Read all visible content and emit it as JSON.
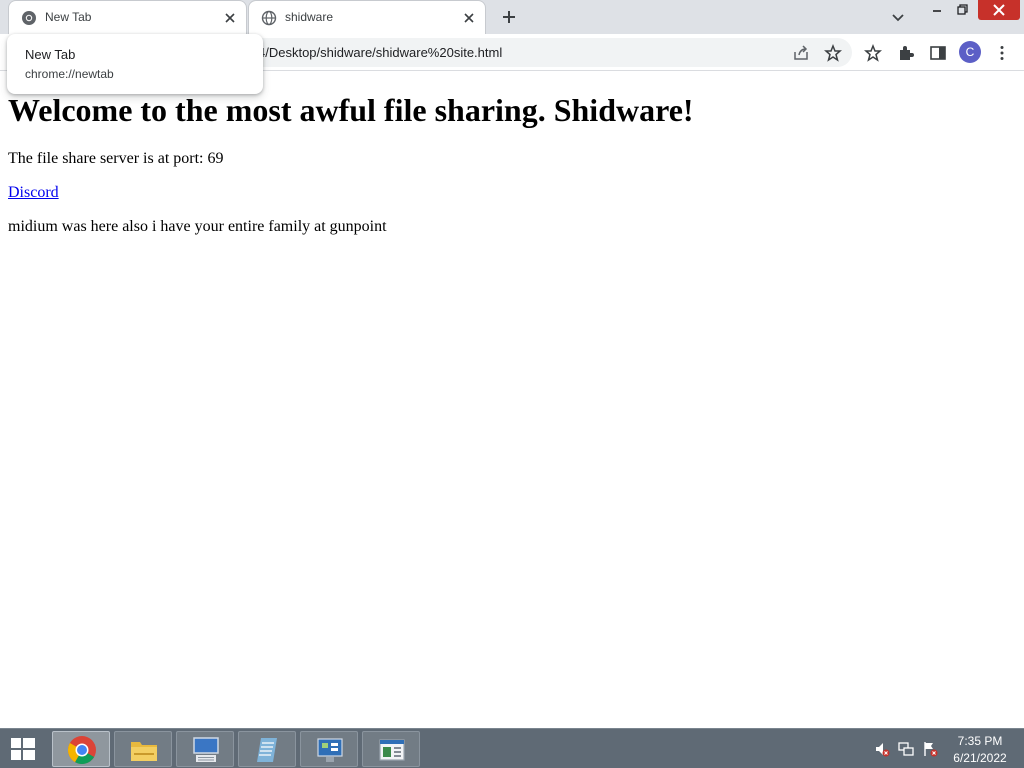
{
  "browser": {
    "tabs": [
      {
        "title": "New Tab",
        "icon": "chrome-icon",
        "active": false
      },
      {
        "title": "shidware",
        "icon": "globe-icon",
        "active": true
      }
    ],
    "hovercard": {
      "title": "New Tab",
      "url": "chrome://newtab"
    },
    "omnibox": {
      "url": "4/Desktop/shidware/shidware%20site.html"
    },
    "profile_initial": "C"
  },
  "page": {
    "heading": "Welcome to the most awful file sharing. Shidware!",
    "port_text": "The file share server is at port: 69",
    "discord_link": "Discord",
    "midium_text": "midium was here also i have your entire family at gunpoint"
  },
  "taskbar": {
    "apps": [
      "chrome-icon",
      "file-explorer-icon",
      "on-screen-keyboard-icon",
      "notepad-icon",
      "control-panel-icon",
      "server-manager-icon"
    ],
    "clock": {
      "time": "7:35 PM",
      "date": "6/21/2022"
    }
  },
  "colors": {
    "close_button": "#c7312a",
    "link": "#0000ee",
    "profile_avatar": "#5c5fc6",
    "taskbar": "#5f6a75"
  }
}
